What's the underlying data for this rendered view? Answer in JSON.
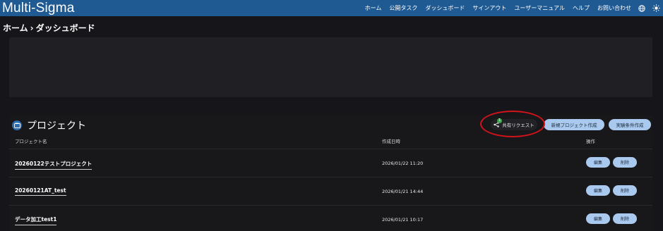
{
  "app": {
    "title": "Multi-Sigma"
  },
  "nav": {
    "items": [
      "ホーム",
      "公開タスク",
      "ダッシュボード",
      "サインアウト",
      "ユーザーマニュアル",
      "ヘルプ",
      "お問い合わせ"
    ],
    "icons": [
      "globe-icon",
      "sun-icon"
    ]
  },
  "breadcrumb": {
    "home": "ホーム",
    "separator": "›",
    "current": "ダッシュボード"
  },
  "projects": {
    "title": "プロジェクト",
    "buttons": {
      "share": "共有リクエスト",
      "share_badge": "1",
      "new": "新規プロジェクト作成",
      "conditions": "実験条件作成"
    },
    "columns": {
      "name": "プロジェクト名",
      "created": "作成日時",
      "actions": "操作"
    },
    "rows": [
      {
        "name": "20260122テストプロジェクト",
        "created": "2026/01/22 11:20",
        "edit": "編集",
        "delete": "削除"
      },
      {
        "name": "20260121AT_test",
        "created": "2026/01/21 14:44",
        "edit": "編集",
        "delete": "削除"
      },
      {
        "name": "データ加工test1",
        "created": "2026/01/21 10:17",
        "edit": "編集",
        "delete": "削除"
      }
    ]
  },
  "colors": {
    "header": "#1f5a93",
    "background": "#16161a",
    "button": "#a9c9ee",
    "highlight_circle": "#d4131b",
    "badge": "#3fa34d"
  }
}
